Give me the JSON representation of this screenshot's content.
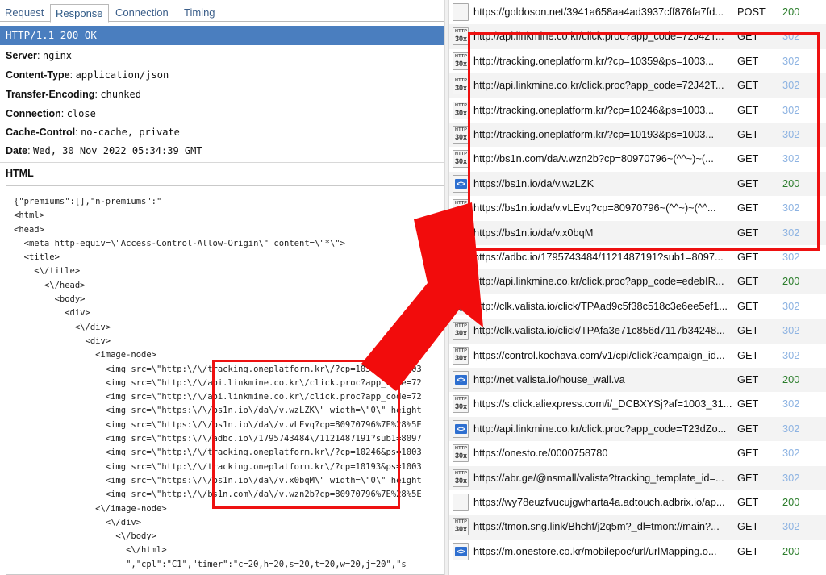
{
  "tabs": [
    "Request",
    "Response",
    "Connection",
    "Timing"
  ],
  "status_line": "HTTP/1.1 200 OK",
  "headers": [
    {
      "key": "Server",
      "value": "nginx"
    },
    {
      "key": "Content-Type",
      "value": "application/json"
    },
    {
      "key": "Transfer-Encoding",
      "value": "chunked"
    },
    {
      "key": "Connection",
      "value": "close"
    },
    {
      "key": "Cache-Control",
      "value": "no-cache, private"
    },
    {
      "key": "Date",
      "value": "Wed, 30 Nov 2022 05:34:39 GMT"
    }
  ],
  "html_section_title": "HTML",
  "code_lines": [
    "{\"premiums\":[],\"n-premiums\":\"",
    "<html>",
    "<head>",
    "  <meta http-equiv=\\\"Access-Control-Allow-Origin\\\" content=\\\"*\\\">",
    "  <title>",
    "    <\\/title>",
    "      <\\/head>",
    "        <body>",
    "          <div>",
    "            <\\/div>",
    "              <div>",
    "                <image-node>",
    "                  <img src=\\\"http:\\/\\/tracking.oneplatform.kr\\/?cp=10359&ps=1003",
    "                  <img src=\\\"http:\\/\\/api.linkmine.co.kr\\/click.proc?app_code=72",
    "                  <img src=\\\"http:\\/\\/api.linkmine.co.kr\\/click.proc?app_code=72",
    "                  <img src=\\\"https:\\/\\/bs1n.io\\/da\\/v.wzLZK\\\" width=\\\"0\\\" height",
    "                  <img src=\\\"https:\\/\\/bs1n.io\\/da\\/v.vLEvq?cp=80970796%7E%28%5E",
    "                  <img src=\\\"https:\\/\\/adbc.io\\/1795743484\\/1121487191?sub1=8097",
    "                  <img src=\\\"http:\\/\\/tracking.oneplatform.kr\\/?cp=10246&ps=1003",
    "                  <img src=\\\"http:\\/\\/tracking.oneplatform.kr\\/?cp=10193&ps=1003",
    "                  <img src=\\\"https:\\/\\/bs1n.io\\/da\\/v.x0bqM\\\" width=\\\"0\\\" height",
    "                  <img src=\\\"http:\\/\\/bs1n.com\\/da\\/v.wzn2b?cp=80970796%7E%28%5E",
    "                <\\/image-node>",
    "                  <\\/div>",
    "                    <\\/body>",
    "                      <\\/html>",
    "                      \",\"cpl\":\"C1\",\"timer\":\"c=20,h=20,s=20,t=20,w=20,j=20\",\"s"
  ],
  "sessions": [
    {
      "icon": "blank",
      "url": "https://goldoson.net/3941a658aa4ad3937cff876fa7fd...",
      "method": "POST",
      "code": "200",
      "mark": false
    },
    {
      "icon": "redirect",
      "url": "http://api.linkmine.co.kr/click.proc?app_code=72J42T...",
      "method": "GET",
      "code": "302",
      "mark": false
    },
    {
      "icon": "redirect",
      "url": "http://tracking.oneplatform.kr/?cp=10359&ps=1003...",
      "method": "GET",
      "code": "302",
      "mark": false
    },
    {
      "icon": "redirect",
      "url": "http://api.linkmine.co.kr/click.proc?app_code=72J42T...",
      "method": "GET",
      "code": "302",
      "mark": false
    },
    {
      "icon": "redirect",
      "url": "http://tracking.oneplatform.kr/?cp=10246&ps=1003...",
      "method": "GET",
      "code": "302",
      "mark": false
    },
    {
      "icon": "redirect",
      "url": "http://tracking.oneplatform.kr/?cp=10193&ps=1003...",
      "method": "GET",
      "code": "302",
      "mark": false
    },
    {
      "icon": "redirect",
      "url": "http://bs1n.com/da/v.wzn2b?cp=80970796~(^^~)~(...",
      "method": "GET",
      "code": "302",
      "mark": false
    },
    {
      "icon": "html",
      "url": "https://bs1n.io/da/v.wzLZK",
      "method": "GET",
      "code": "200",
      "mark": true
    },
    {
      "icon": "redirect",
      "url": "https://bs1n.io/da/v.vLEvq?cp=80970796~(^^~)~(^^...",
      "method": "GET",
      "code": "302",
      "mark": false
    },
    {
      "icon": "redirect",
      "url": "https://bs1n.io/da/v.x0bqM",
      "method": "GET",
      "code": "302",
      "mark": false
    },
    {
      "icon": "redirect",
      "url": "https://adbc.io/1795743484/1121487191?sub1=8097...",
      "method": "GET",
      "code": "302",
      "mark": false
    },
    {
      "icon": "html",
      "url": "http://api.linkmine.co.kr/click.proc?app_code=edebIR...",
      "method": "GET",
      "code": "200",
      "mark": true
    },
    {
      "icon": "redirect",
      "url": "http://clk.valista.io/click/TPAad9c5f38c518c3e6ee5ef1...",
      "method": "GET",
      "code": "302",
      "mark": false
    },
    {
      "icon": "redirect",
      "url": "http://clk.valista.io/click/TPAfa3e71c856d7117b34248...",
      "method": "GET",
      "code": "302",
      "mark": false
    },
    {
      "icon": "redirect",
      "url": "https://control.kochava.com/v1/cpi/click?campaign_id...",
      "method": "GET",
      "code": "302",
      "mark": true
    },
    {
      "icon": "html",
      "url": "http://net.valista.io/house_wall.va",
      "method": "GET",
      "code": "200",
      "mark": true
    },
    {
      "icon": "redirect",
      "url": "https://s.click.aliexpress.com/i/_DCBXYSj?af=1003_31...",
      "method": "GET",
      "code": "302",
      "mark": false
    },
    {
      "icon": "html",
      "url": "http://api.linkmine.co.kr/click.proc?app_code=T23dZo...",
      "method": "GET",
      "code": "302",
      "mark": false
    },
    {
      "icon": "redirect",
      "url": "https://onesto.re/0000758780",
      "method": "GET",
      "code": "302",
      "mark": false
    },
    {
      "icon": "redirect",
      "url": "https://abr.ge/@nsmall/valista?tracking_template_id=...",
      "method": "GET",
      "code": "302",
      "mark": false
    },
    {
      "icon": "blank",
      "url": "https://wy78euzfvucujgwharta4a.adtouch.adbrix.io/ap...",
      "method": "GET",
      "code": "200",
      "mark": true
    },
    {
      "icon": "redirect",
      "url": "https://tmon.sng.link/Bhchf/j2q5m?_dl=tmon://main?...",
      "method": "GET",
      "code": "302",
      "mark": false
    },
    {
      "icon": "html",
      "url": "https://m.onestore.co.kr/mobilepoc/url/urlMapping.o...",
      "method": "GET",
      "code": "200",
      "mark": true
    }
  ],
  "icon_labels": {
    "redirect_top": "HTTP",
    "redirect_bottom": "30x",
    "html": "<>"
  },
  "colors": {
    "status_bar": "#4a7ebf",
    "code_200": "#2b7d2b",
    "code_302": "#8db3e2",
    "highlight": "#ee1111",
    "success_mark": "#8cc979"
  }
}
